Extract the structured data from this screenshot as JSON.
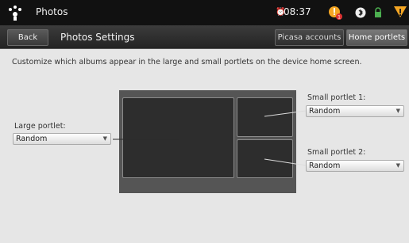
{
  "status_bar": {
    "app_name": "Photos",
    "time": "08:37",
    "icons": [
      "photos-app-icon",
      "alarm-icon",
      "notification-alert-icon",
      "bluetooth-icon",
      "lock-icon",
      "signal-warning-icon"
    ],
    "notification_count": "1"
  },
  "title_bar": {
    "back_label": "Back",
    "title": "Photos Settings",
    "tabs": [
      {
        "label": "Picasa accounts",
        "selected": false
      },
      {
        "label": "Home portlets",
        "selected": true
      }
    ]
  },
  "content": {
    "description": "Customize which albums appear in the large and small portlets on the device home screen.",
    "large_portlet": {
      "label": "Large portlet:",
      "value": "Random"
    },
    "small_portlet_1": {
      "label": "Small portlet 1:",
      "value": "Random"
    },
    "small_portlet_2": {
      "label": "Small portlet 2:",
      "value": "Random"
    }
  },
  "colors": {
    "status_bar": "#111111",
    "background": "#e6e6e6",
    "diagram_frame": "#555555",
    "portlet": "#2d2d2d",
    "alert": "#f5a623"
  }
}
